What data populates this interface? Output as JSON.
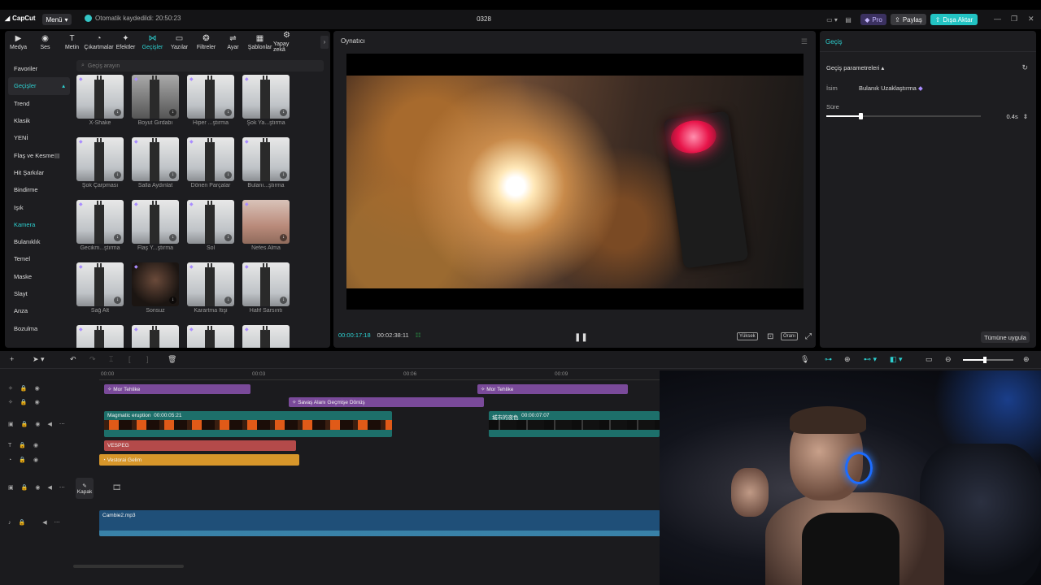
{
  "app": {
    "logo_text": "CapCut",
    "menu_label": "Menü",
    "autosave_text": "Otomatik kaydedildi: 20:50:23",
    "project_title": "0328",
    "pro_label": "Pro",
    "share_label": "Paylaş",
    "export_label": "Dışa Aktar"
  },
  "tool_tabs": [
    {
      "label": "Medya",
      "icon": "▶"
    },
    {
      "label": "Ses",
      "icon": "◉"
    },
    {
      "label": "Metin",
      "icon": "T"
    },
    {
      "label": "Çıkartmalar",
      "icon": "◔"
    },
    {
      "label": "Efektler",
      "icon": "✦"
    },
    {
      "label": "Geçişler",
      "icon": "⋈"
    },
    {
      "label": "Yazılar",
      "icon": "▭"
    },
    {
      "label": "Filtreler",
      "icon": "❂"
    },
    {
      "label": "Ayar",
      "icon": "⇌"
    },
    {
      "label": "Şablonlar",
      "icon": "▦"
    },
    {
      "label": "Yapay zekâ",
      "icon": "⚙"
    }
  ],
  "active_tab": "Geçişler",
  "categories": [
    "Favoriler",
    "Geçişler",
    "Trend",
    "Klasik",
    "YENİ",
    "Flaş ve Kesme",
    "Hit Şarkılar",
    "Bindirme",
    "Işık",
    "Kamera",
    "Bulanıklık",
    "Temel",
    "Maske",
    "Slayt",
    "Anza",
    "Bozulma"
  ],
  "search_placeholder": "Geçiş arayın",
  "transitions": [
    "X-Shake",
    "Boyut Girdabı",
    "Hiper ...ştırma",
    "Şok Ya...ştırma",
    "Şok Çarpması",
    "Salla Aydınlat",
    "Dönen Parçalar",
    "Bulanı...ştırma",
    "Gecikm...ştırma",
    "Flaş Y...ştırma",
    "Sol",
    "Nefes Alma",
    "Sağ Alt",
    "Sonsuz",
    "Karartma İtişi",
    "Hafif Sarsıntı",
    "",
    "",
    "",
    ""
  ],
  "player": {
    "title": "Oynatıcı",
    "current_time": "00:00:17:18",
    "total_time": "00:02:38:11",
    "quality_label": "Yüksek",
    "ratio_label": "Oranı"
  },
  "inspector": {
    "tab_label": "Geçiş",
    "section_title": "Geçiş parametreleri",
    "name_label": "İsim",
    "name_value": "Bulanık Uzaklaştırma",
    "duration_label": "Süre",
    "duration_value": "0.4s",
    "duration_level": 0.22,
    "apply_all_label": "Tümüne uygula"
  },
  "timeline": {
    "ruler": [
      "00:00",
      "00:03",
      "00:06",
      "00:09"
    ],
    "clips": {
      "fx1": "Mor Tehlike",
      "fx2": "Savaş Alanı Geçmişe Dönüş",
      "fx3": "Mor Tehlike",
      "video1_name": "Magmatic eruption",
      "video1_dur": "00:00:05:21",
      "video2_name": "城市的夜色",
      "video2_dur": "00:00:07:07",
      "text1": "VESPEG",
      "filter1": "Vestorai Gelim",
      "audio1": "Cambie2.mp3"
    },
    "cover_label": "Kapak",
    "zoom_level": 0.4
  }
}
